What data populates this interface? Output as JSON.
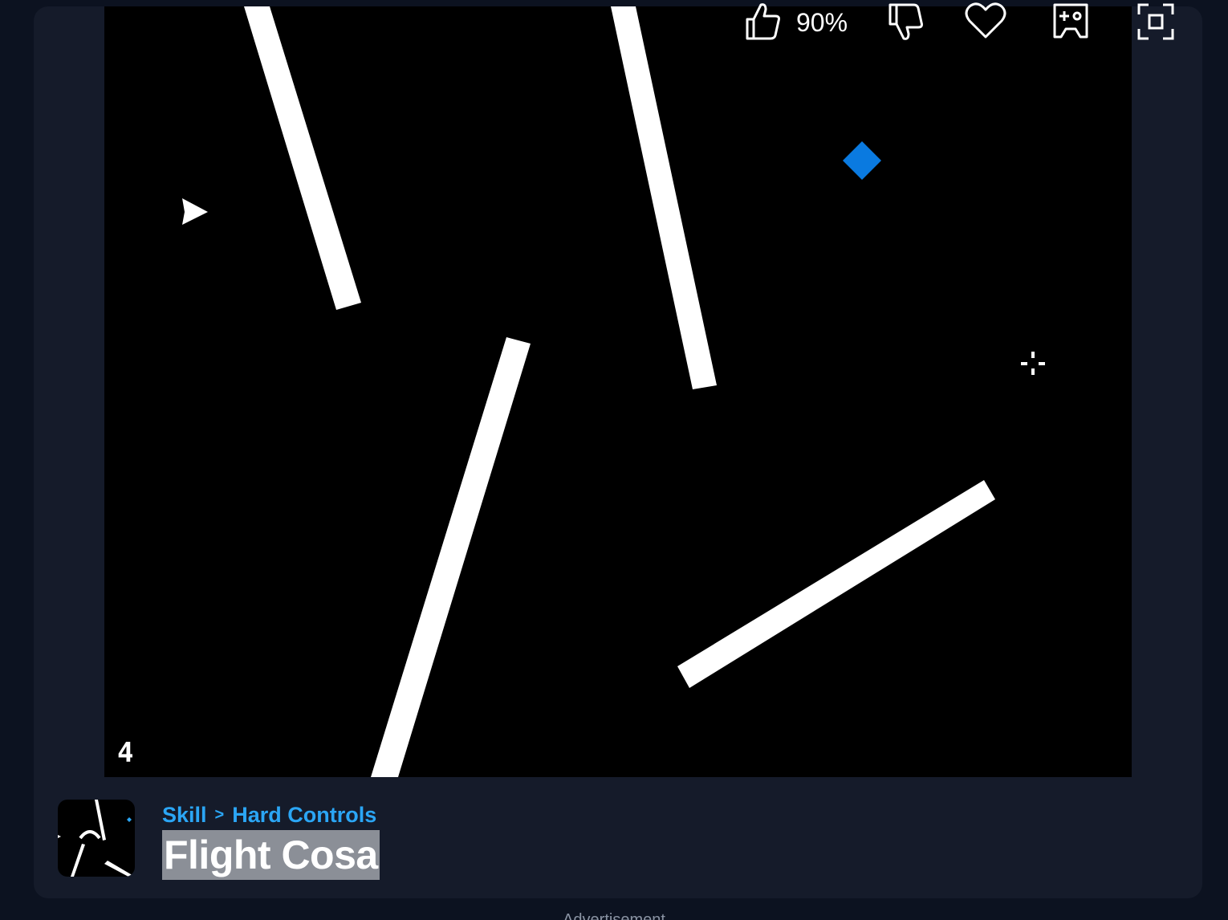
{
  "game": {
    "level_number": "4",
    "colors": {
      "background": "#000000",
      "walls": "#ffffff",
      "goal": "#0a7ae0",
      "player": "#ffffff"
    },
    "icons": {
      "player": "player-arrow-icon",
      "goal": "goal-diamond-icon",
      "cursor": "crosshair-icon"
    }
  },
  "info": {
    "breadcrumb": {
      "category": "Skill",
      "separator": ">",
      "subcategory": "Hard Controls"
    },
    "title": "Flight Cosa"
  },
  "actions": {
    "like_percent": "90%",
    "icons": [
      "thumbs-up-icon",
      "thumbs-down-icon",
      "heart-icon",
      "gamepad-icon",
      "fullscreen-icon"
    ]
  },
  "footer": {
    "ad_label": "Advertisement"
  },
  "theme": {
    "page_bg": "#0c1220",
    "card_bg": "#151b2a",
    "link_color": "#2ba6f5"
  }
}
